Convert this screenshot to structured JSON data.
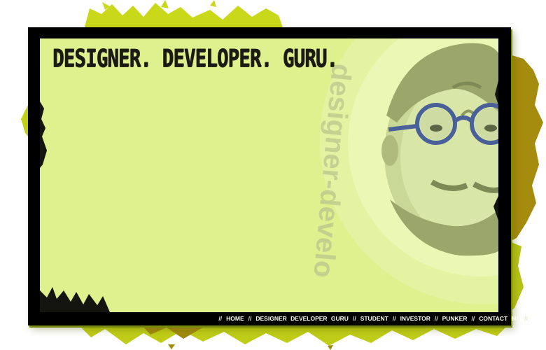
{
  "page": {
    "title": "DESIGNER. DEVELOPER. GURU.",
    "watermark": "designer-develo"
  },
  "nav": {
    "separator": "//",
    "items": [
      {
        "label": "HOME"
      },
      {
        "label": "DESIGNER  DEVELOPER  GURU"
      },
      {
        "label": "STUDENT"
      },
      {
        "label": "INVESTOR"
      },
      {
        "label": "PUNKER"
      },
      {
        "label": "CONTACT  ME"
      }
    ]
  },
  "colors": {
    "panel": "#dff08f",
    "frame": "#000000",
    "splatter_yellow": "#c8d818",
    "splatter_olive": "#a89010",
    "glasses": "#4a6098"
  }
}
